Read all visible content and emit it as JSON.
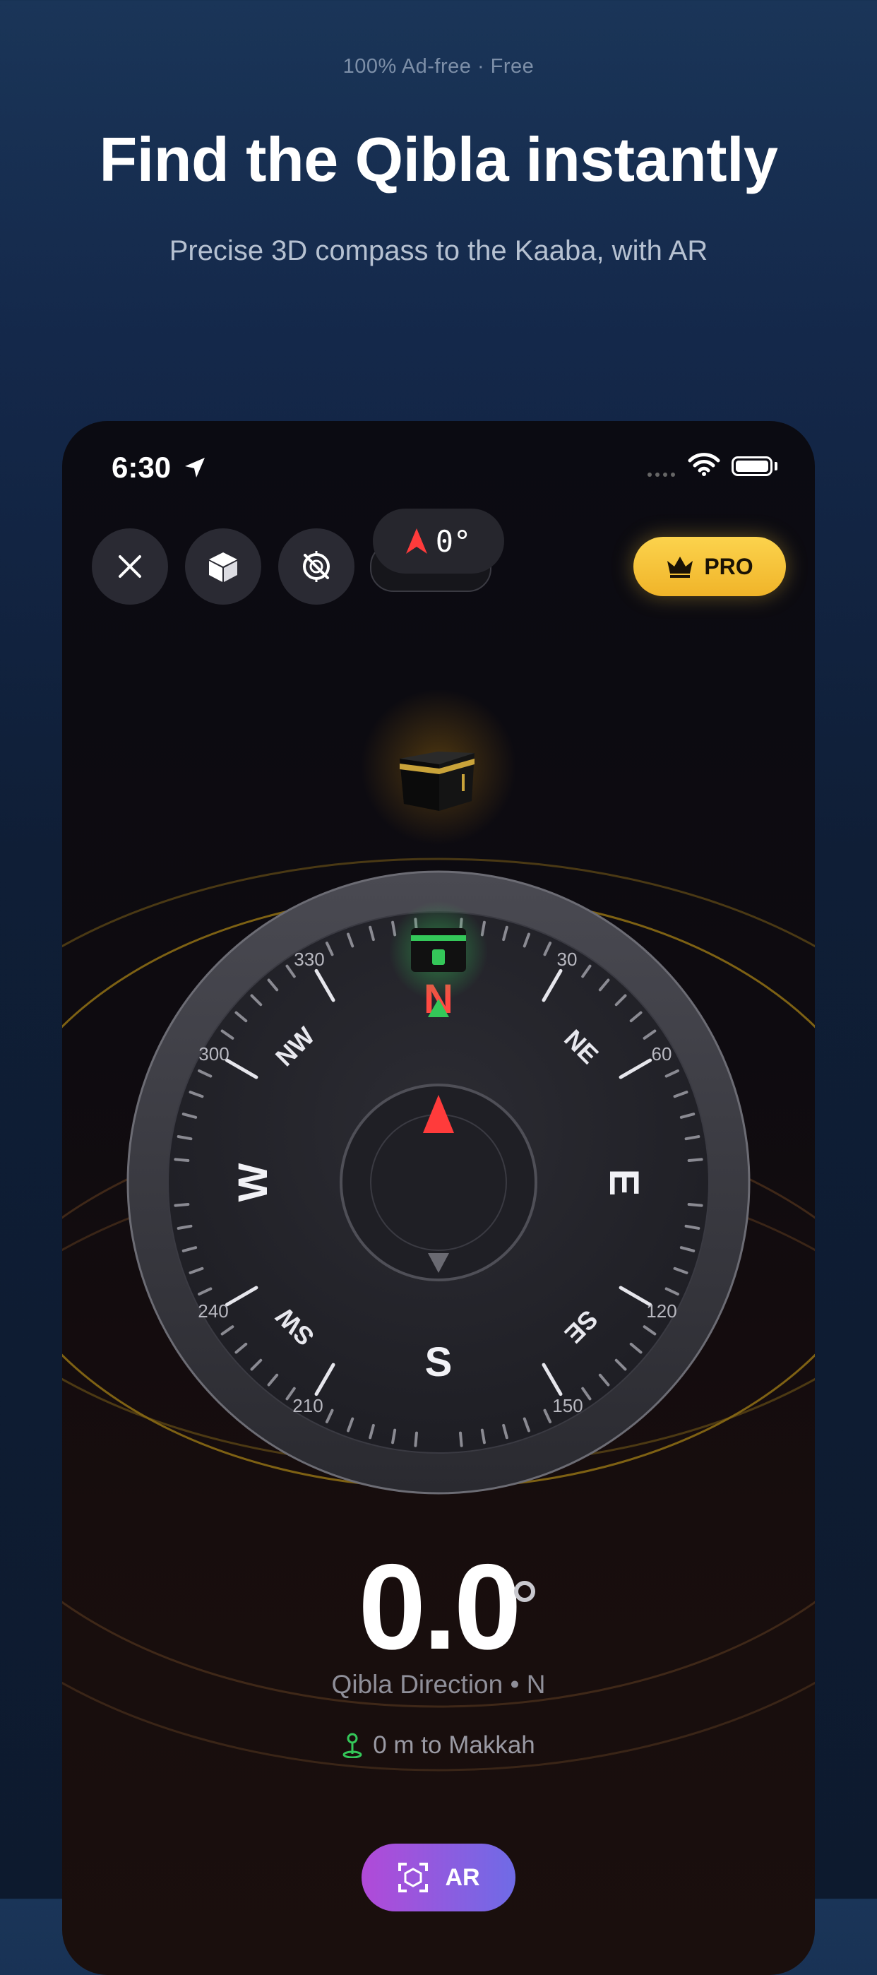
{
  "promo": {
    "tag": "100% Ad-free · Free",
    "title": "Find the Qibla instantly",
    "subtitle": "Precise 3D compass to the Kaaba, with AR"
  },
  "status_bar": {
    "time": "6:30"
  },
  "toolbar": {
    "close_icon": "close-icon",
    "view_3d_icon": "cube-icon",
    "calibrate_icon": "crosshair-icon",
    "heading_value": "0°",
    "pro_label": "PRO"
  },
  "compass": {
    "cardinals": [
      "N",
      "E",
      "S",
      "W"
    ],
    "intercardinals": [
      "NE",
      "SE",
      "SW",
      "NW"
    ],
    "degree_labels": [
      "30",
      "60",
      "120",
      "150",
      "210",
      "240",
      "300",
      "330"
    ],
    "heading_degrees": 0,
    "colors": {
      "north": "#ff3b3b",
      "qibla": "#34c759",
      "ring": "#d4a017"
    }
  },
  "reading": {
    "value": "0.0",
    "label": "Qibla Direction • N",
    "distance": "0 m to Makkah"
  },
  "ar_button": {
    "label": "AR"
  }
}
